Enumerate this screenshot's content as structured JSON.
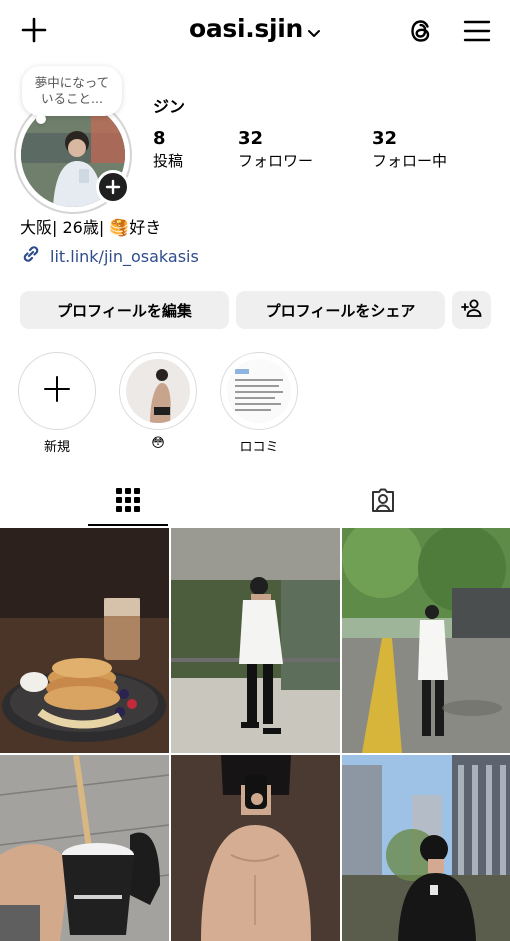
{
  "header": {
    "username": "oasi.sjin",
    "icons": [
      "plus-icon",
      "chevron-down-icon",
      "threads-icon",
      "menu-icon"
    ]
  },
  "note": {
    "line1": "夢中になって",
    "line2": "いること..."
  },
  "profile": {
    "display_name": "ジン",
    "stats": [
      {
        "value": "8",
        "label": "投稿"
      },
      {
        "value": "32",
        "label": "フォロワー"
      },
      {
        "value": "32",
        "label": "フォロー中"
      }
    ],
    "bio": "大阪| 26歳| 🥞好き",
    "link": "lit.link/jin_osakasis"
  },
  "buttons": {
    "edit": "プロフィールを編集",
    "share": "プロフィールをシェア"
  },
  "highlights": [
    {
      "label": "新規"
    },
    {
      "label": "😳"
    },
    {
      "label": "ロコミ"
    }
  ],
  "tabs": [
    "grid-icon",
    "tagged-icon"
  ],
  "posts": [
    {
      "subject": "pancakes-and-iced-latte"
    },
    {
      "subject": "man-in-white-shirt-under-awning"
    },
    {
      "subject": "man-in-white-shirt-tree-lined-path"
    },
    {
      "subject": "hand-holding-downstairs-coffee-cup"
    },
    {
      "subject": "mirror-selfie-shirtless"
    },
    {
      "subject": "man-with-coffee-city-buildings"
    }
  ],
  "colors": {
    "link": "#2f4d8c",
    "button_bg": "#efefef",
    "text": "#000000"
  }
}
